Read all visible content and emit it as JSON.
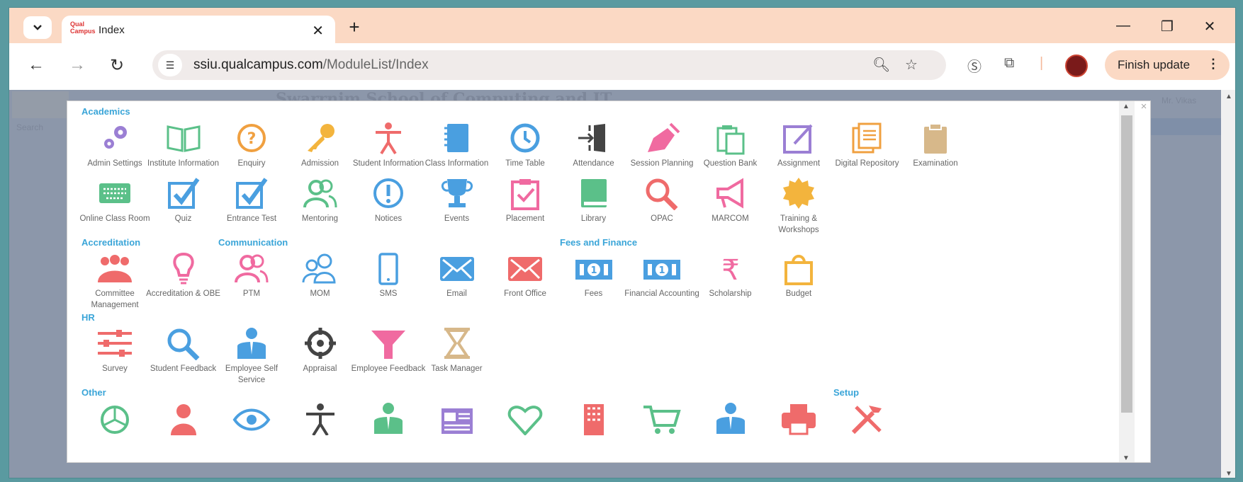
{
  "browser": {
    "tab_title": "Index",
    "favicon_text": "Qual Campus",
    "url_host": "ssiu.qualcampus.com",
    "url_path": "/ModuleList/Index",
    "update_label": "Finish update"
  },
  "background": {
    "title": "Swarrnim School of Computing and IT",
    "search_placeholder": "Search",
    "user_name": "Mr. Vikas"
  },
  "sections": [
    {
      "label": "Academics"
    },
    {
      "label": "Accreditation"
    },
    {
      "label": "Communication"
    },
    {
      "label": "Fees and Finance"
    },
    {
      "label": "HR"
    },
    {
      "label": "Other"
    },
    {
      "label": "Setup"
    }
  ],
  "modules": [
    {
      "label": "Admin Settings",
      "icon": "gear-icon",
      "color": "#9b7fd4"
    },
    {
      "label": "Institute Information",
      "icon": "book-open-icon",
      "color": "#5bc089"
    },
    {
      "label": "Enquiry",
      "icon": "question-icon",
      "color": "#f0a040"
    },
    {
      "label": "Admission",
      "icon": "key-icon",
      "color": "#f3b43d"
    },
    {
      "label": "Student Information",
      "icon": "person-star-icon",
      "color": "#ef6b6b"
    },
    {
      "label": "Class Information",
      "icon": "notebook-icon",
      "color": "#4a9fe0"
    },
    {
      "label": "Time Table",
      "icon": "clock-icon",
      "color": "#4a9fe0"
    },
    {
      "label": "Attendance",
      "icon": "door-enter-icon",
      "color": "#444444"
    },
    {
      "label": "Session Planning",
      "icon": "pen-nib-icon",
      "color": "#f06aa0"
    },
    {
      "label": "Question Bank",
      "icon": "clipboard-copy-icon",
      "color": "#5bc089"
    },
    {
      "label": "Assignment",
      "icon": "edit-square-icon",
      "color": "#9b7fd4"
    },
    {
      "label": "Digital Repository",
      "icon": "documents-icon",
      "color": "#f0a040"
    },
    {
      "label": "Examination",
      "icon": "clipboard-icon",
      "color": "#d7b88a"
    },
    {
      "label": "Online Class Room",
      "icon": "keyboard-icon",
      "color": "#5bc089"
    },
    {
      "label": "Quiz",
      "icon": "checkbox-icon",
      "color": "#4a9fe0"
    },
    {
      "label": "Entrance Test",
      "icon": "checkbox-icon",
      "color": "#4a9fe0"
    },
    {
      "label": "Mentoring",
      "icon": "users-icon",
      "color": "#5bc089"
    },
    {
      "label": "Notices",
      "icon": "alert-circle-icon",
      "color": "#4a9fe0"
    },
    {
      "label": "Events",
      "icon": "trophy-icon",
      "color": "#4a9fe0"
    },
    {
      "label": "Placement",
      "icon": "clipboard-check-icon",
      "color": "#f06aa0"
    },
    {
      "label": "Library",
      "icon": "book-icon",
      "color": "#5bc089"
    },
    {
      "label": "OPAC",
      "icon": "search-icon",
      "color": "#ef6b6b"
    },
    {
      "label": "MARCOM",
      "icon": "megaphone-icon",
      "color": "#f06aa0"
    },
    {
      "label": "Training & Workshops",
      "icon": "badge-icon",
      "color": "#f3b43d"
    },
    {
      "label": "Committee Management",
      "icon": "group-icon",
      "color": "#ef6b6b"
    },
    {
      "label": "Accreditation & OBE",
      "icon": "lightbulb-icon",
      "color": "#f06aa0"
    },
    {
      "label": "PTM",
      "icon": "users-icon",
      "color": "#f06aa0"
    },
    {
      "label": "MOM",
      "icon": "users-outline-icon",
      "color": "#4a9fe0"
    },
    {
      "label": "SMS",
      "icon": "phone-icon",
      "color": "#4a9fe0"
    },
    {
      "label": "Email",
      "icon": "mail-icon",
      "color": "#4a9fe0"
    },
    {
      "label": "Front Office",
      "icon": "mail-icon",
      "color": "#ef6b6b"
    },
    {
      "label": "Fees",
      "icon": "banknote-icon",
      "color": "#4a9fe0"
    },
    {
      "label": "Financial Accounting",
      "icon": "banknote-icon",
      "color": "#4a9fe0"
    },
    {
      "label": "Scholarship",
      "icon": "rupee-icon",
      "color": "#f06aa0"
    },
    {
      "label": "Budget",
      "icon": "bag-icon",
      "color": "#f3b43d"
    },
    {
      "label": "Survey",
      "icon": "sliders-icon",
      "color": "#ef6b6b"
    },
    {
      "label": "Student Feedback",
      "icon": "search-icon",
      "color": "#4a9fe0"
    },
    {
      "label": "Employee Self Service",
      "icon": "employee-icon",
      "color": "#4a9fe0"
    },
    {
      "label": "Appraisal",
      "icon": "target-icon",
      "color": "#444444"
    },
    {
      "label": "Employee Feedback",
      "icon": "funnel-icon",
      "color": "#f06aa0"
    },
    {
      "label": "Task Manager",
      "icon": "hourglass-icon",
      "color": "#d7b88a"
    },
    {
      "label": "",
      "icon": "pie-icon",
      "color": "#5bc089"
    },
    {
      "label": "",
      "icon": "person-icon",
      "color": "#ef6b6b"
    },
    {
      "label": "",
      "icon": "eye-icon",
      "color": "#4a9fe0"
    },
    {
      "label": "",
      "icon": "accessibility-icon",
      "color": "#444444"
    },
    {
      "label": "",
      "icon": "employee-icon",
      "color": "#5bc089"
    },
    {
      "label": "",
      "icon": "newspaper-icon",
      "color": "#9b7fd4"
    },
    {
      "label": "",
      "icon": "heart-icon",
      "color": "#5bc089"
    },
    {
      "label": "",
      "icon": "building-icon",
      "color": "#ef6b6b"
    },
    {
      "label": "",
      "icon": "cart-icon",
      "color": "#5bc089"
    },
    {
      "label": "",
      "icon": "employee-icon",
      "color": "#4a9fe0"
    },
    {
      "label": "",
      "icon": "printer-icon",
      "color": "#ef6b6b"
    },
    {
      "label": "",
      "icon": "tools-icon",
      "color": "#ef6b6b"
    }
  ]
}
